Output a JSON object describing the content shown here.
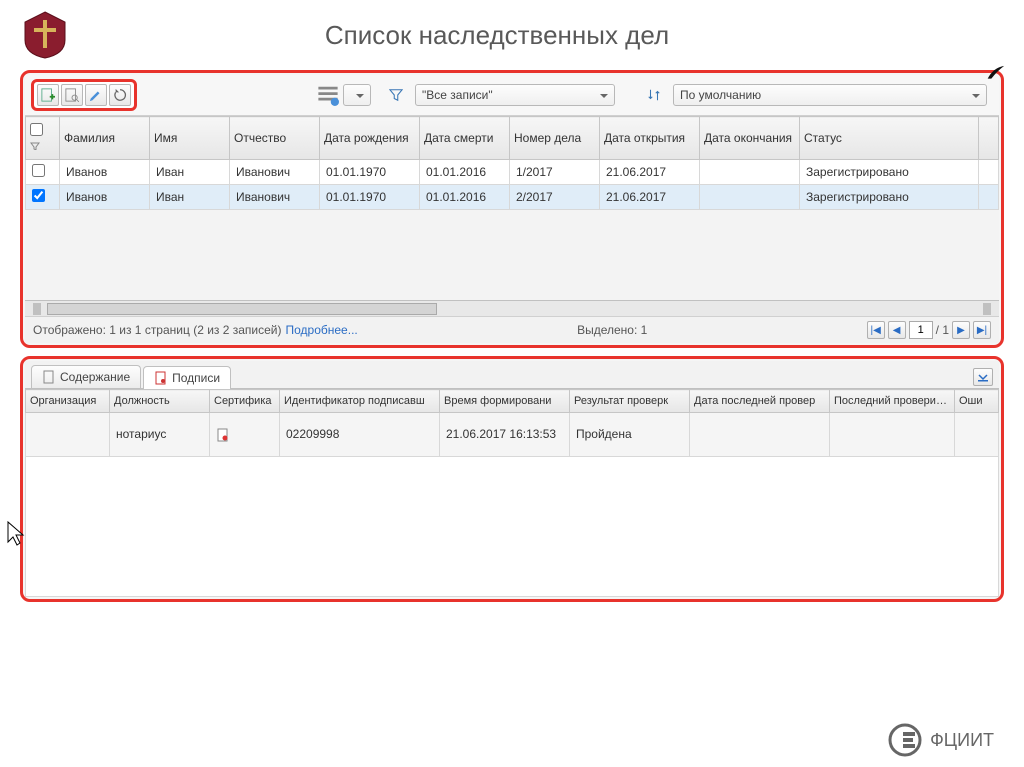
{
  "header": {
    "title": "Список наследственных дел"
  },
  "toolbar": {
    "filter_label": "\"Все записи\"",
    "sort_label": "По умолчанию"
  },
  "grid": {
    "headers": {
      "lastname": "Фамилия",
      "firstname": "Имя",
      "patronymic": "Отчество",
      "birth": "Дата рождения",
      "death": "Дата смерти",
      "caseno": "Номер дела",
      "opened": "Дата открытия",
      "closed": "Дата окончания",
      "status": "Статус"
    },
    "rows": [
      {
        "checked": false,
        "lastname": "Иванов",
        "firstname": "Иван",
        "patronymic": "Иванович",
        "birth": "01.01.1970",
        "death": "01.01.2016",
        "caseno": "1/2017",
        "opened": "21.06.2017",
        "closed": "",
        "status": "Зарегистрировано"
      },
      {
        "checked": true,
        "lastname": "Иванов",
        "firstname": "Иван",
        "patronymic": "Иванович",
        "birth": "01.01.1970",
        "death": "01.01.2016",
        "caseno": "2/2017",
        "opened": "21.06.2017",
        "closed": "",
        "status": "Зарегистрировано"
      }
    ],
    "status_text": "Отображено: 1 из 1 страниц (2 из 2 записей)",
    "more_link": "Подробнее...",
    "selected_text": "Выделено:  1",
    "page_current": "1",
    "page_total": "/ 1"
  },
  "tabs": {
    "content": "Содержание",
    "signatures": "Подписи"
  },
  "sig": {
    "headers": {
      "org": "Организация",
      "role": "Должность",
      "cert": "Сертифика",
      "signer_id": "Идентификатор подписавш",
      "time": "Время формировани",
      "result": "Результат проверк",
      "last_check": "Дата последней провер",
      "last_checker": "Последний проверивший",
      "err": "Оши"
    },
    "row": {
      "org": "",
      "role": "нотариус",
      "signer_id": "02209998",
      "time": "21.06.2017 16:13:53",
      "result": "Пройдена",
      "last_check": "",
      "last_checker": "",
      "err": ""
    }
  },
  "footer": {
    "label": "ФЦИИТ"
  }
}
